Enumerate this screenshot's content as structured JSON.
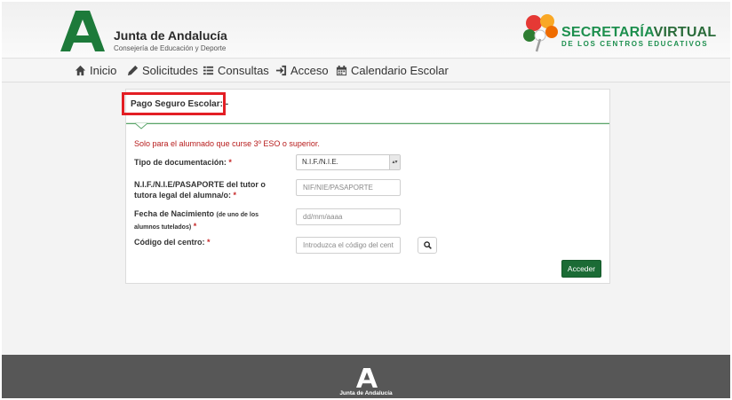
{
  "header": {
    "brand_title": "Junta de Andalucía",
    "brand_subtitle": "Consejería de Educación y Deporte",
    "portal_title_a": "SECRETARÍA",
    "portal_title_b": "VIRTUAL",
    "portal_subtitle": "DE LOS CENTROS EDUCATIVOS"
  },
  "nav": {
    "items": [
      {
        "label": "Inicio",
        "icon": "home-icon"
      },
      {
        "label": "Solicitudes",
        "icon": "pencil-icon"
      },
      {
        "label": "Consultas",
        "icon": "list-icon"
      },
      {
        "label": "Acceso",
        "icon": "sign-in-icon"
      },
      {
        "label": "Calendario Escolar",
        "icon": "calendar-icon"
      }
    ]
  },
  "panel": {
    "title": "Pago Seguro Escolar: -",
    "notice": "Solo para el alumnado que curse 3º ESO o superior.",
    "fields": {
      "doc_type": {
        "label": "Tipo de documentación:",
        "required": "*",
        "value": "N.I.F./N.I.E."
      },
      "tutor_id": {
        "label_line1": "N.I.F./N.I.E/PASAPORTE del tutor o",
        "label_line2": "tutora legal del alumna/o:",
        "required": "*",
        "placeholder": "NIF/NIE/PASAPORTE"
      },
      "birth_date": {
        "label": "Fecha de Nacimiento",
        "label_note_line1": "(de uno de los",
        "label_note_line2": "alumnos tutelados)",
        "required": "*",
        "placeholder": "dd/mm/aaaa"
      },
      "center_code": {
        "label": "Código del centro:",
        "required": "*",
        "placeholder": "Introduzca el código del centro"
      }
    },
    "submit_label": "Acceder"
  },
  "footer": {
    "text": "Junta de Andalucía"
  },
  "colors": {
    "brand_green": "#1b6b35",
    "highlight_red": "#e31e24",
    "required_red": "#c62828"
  }
}
